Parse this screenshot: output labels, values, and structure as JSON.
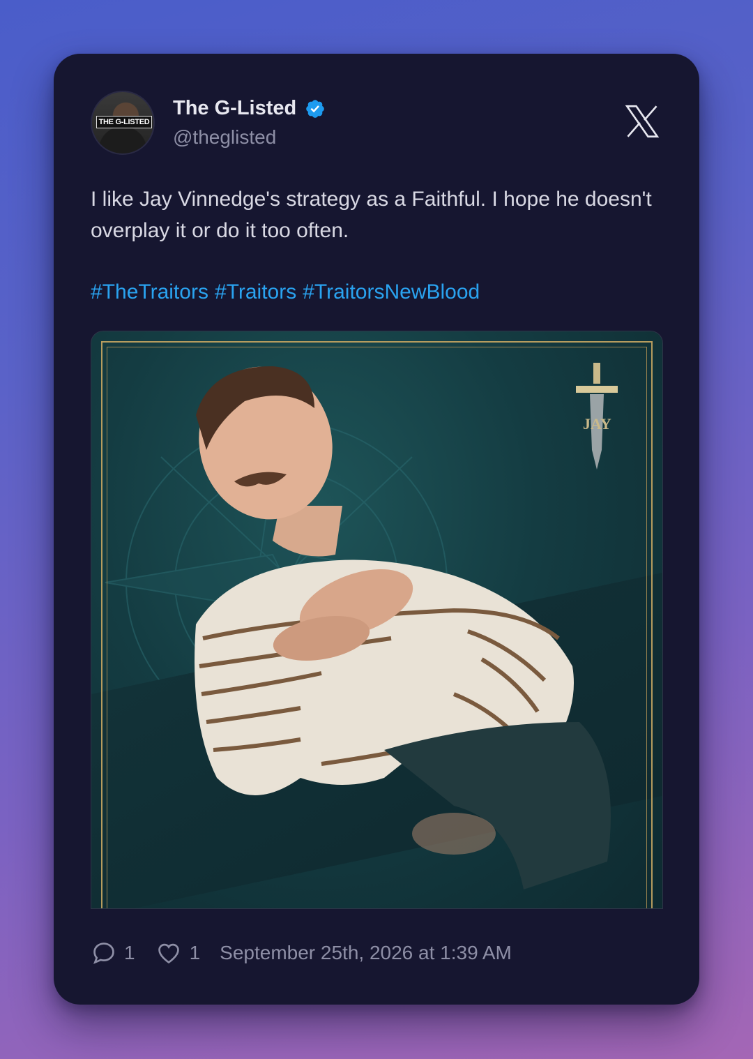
{
  "author": {
    "display_name": "The G-Listed",
    "handle": "@theglisted",
    "avatar_text": "THE G-LISTED",
    "verified": true
  },
  "tweet": {
    "text": "I like Jay Vinnedge's strategy as a Faithful. I hope he doesn't overplay it or do it too often.",
    "hashtags": [
      "#TheTraitors",
      "#Traitors",
      "#TraitorsNewBlood"
    ]
  },
  "media": {
    "overlay_label": "JAY"
  },
  "footer": {
    "replies": "1",
    "likes": "1",
    "timestamp": "September 25th, 2026 at 1:39 AM"
  },
  "colors": {
    "card_bg": "#161630",
    "hashtag": "#2aa3f0",
    "verified_badge": "#1d9bf0",
    "frame_gold": "#b69c5e"
  },
  "icons": [
    "verified-badge-icon",
    "x-logo-icon",
    "reply-icon",
    "like-icon",
    "dagger-icon"
  ]
}
